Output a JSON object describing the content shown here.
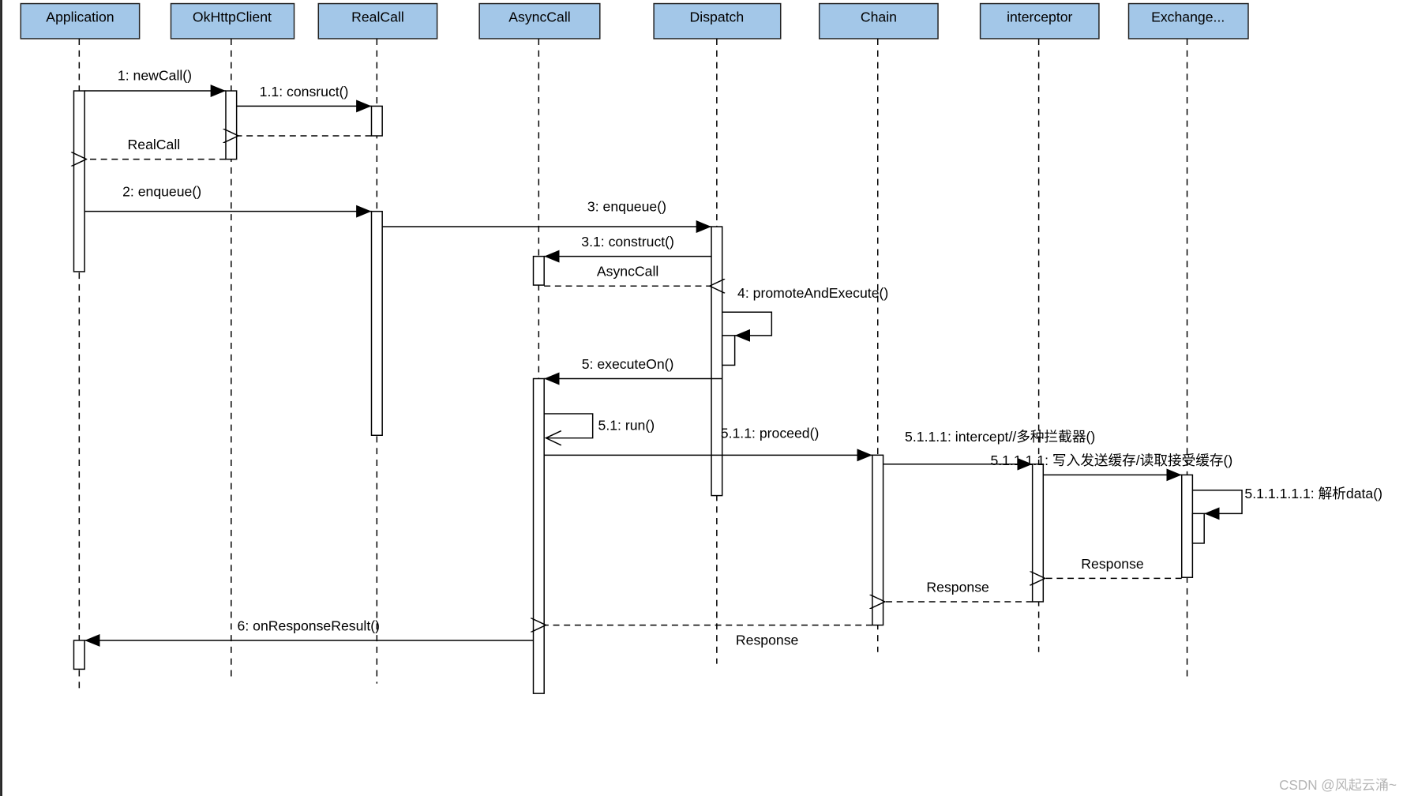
{
  "participants": [
    "Application",
    "OkHttpClient",
    "RealCall",
    "AsyncCall",
    "Dispatch",
    "Chain",
    "interceptor",
    "Exchange..."
  ],
  "messages": {
    "m1": "1: newCall()",
    "m1_1": "1.1: consruct()",
    "r_realcall": "RealCall",
    "m2": "2: enqueue()",
    "m3": "3: enqueue()",
    "m3_1": "3.1: construct()",
    "r_asynccall": "AsyncCall",
    "m4": "4: promoteAndExecute()",
    "m5": "5: executeOn()",
    "m5_1": "5.1: run()",
    "m5_1_1": "5.1.1: proceed()",
    "m5_1_1_1": "5.1.1.1: intercept//多种拦截器()",
    "m5_1_1_1_1": "5.1.1.1.1: 写入发送缓存/读取接受缓存()",
    "m5_1_1_1_1_1": "5.1.1.1.1.1: 解析data()",
    "r_response_1": "Response",
    "r_response_2": "Response",
    "r_response_3": "Response",
    "m6": "6: onResponseResult()"
  },
  "watermark": "CSDN @风起云涌~",
  "colors": {
    "participant_fill": "#a3c7e8"
  }
}
